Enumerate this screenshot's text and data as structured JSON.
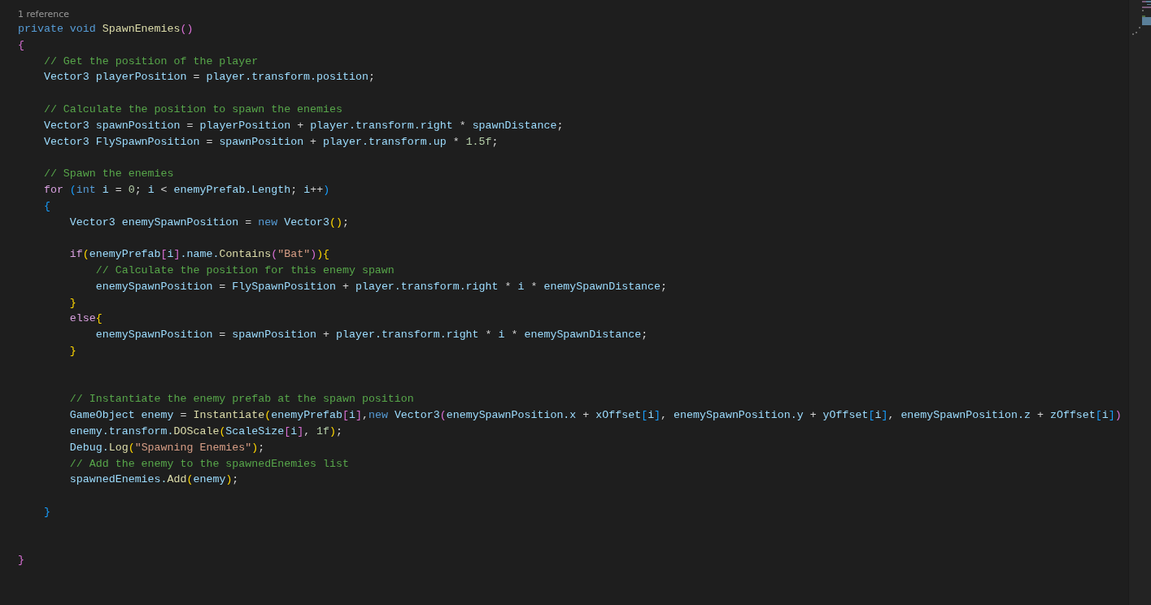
{
  "editor": {
    "code_lens": "1 reference",
    "lines": [
      {
        "kind": "code",
        "tokens": [
          {
            "text": "private void ",
            "kind": "kw"
          },
          {
            "text": "SpawnEnemies",
            "kind": "fn"
          },
          {
            "text": "()",
            "kind": "b2"
          }
        ]
      },
      {
        "kind": "code",
        "tokens": [
          {
            "text": "{",
            "kind": "b2"
          }
        ]
      },
      {
        "kind": "code",
        "tokens": [
          {
            "text": "    // Get the position of the player",
            "kind": "cm"
          }
        ]
      },
      {
        "kind": "code",
        "tokens": [
          {
            "text": "    Vector3 playerPosition",
            "kind": "id"
          },
          {
            "text": " = ",
            "kind": "op"
          },
          {
            "text": "player.transform.position",
            "kind": "id"
          },
          {
            "text": ";",
            "kind": "op"
          }
        ]
      },
      {
        "kind": "blank"
      },
      {
        "kind": "code",
        "tokens": [
          {
            "text": "    // Calculate the position to spawn the enemies",
            "kind": "cm"
          }
        ]
      },
      {
        "kind": "code",
        "tokens": [
          {
            "text": "    Vector3 spawnPosition",
            "kind": "id"
          },
          {
            "text": " = ",
            "kind": "op"
          },
          {
            "text": "playerPosition",
            "kind": "id"
          },
          {
            "text": " + ",
            "kind": "op"
          },
          {
            "text": "player.transform.right",
            "kind": "id"
          },
          {
            "text": " * ",
            "kind": "op"
          },
          {
            "text": "spawnDistance",
            "kind": "id"
          },
          {
            "text": ";",
            "kind": "op"
          }
        ]
      },
      {
        "kind": "code",
        "tokens": [
          {
            "text": "    Vector3 FlySpawnPosition",
            "kind": "id"
          },
          {
            "text": " = ",
            "kind": "op"
          },
          {
            "text": "spawnPosition",
            "kind": "id"
          },
          {
            "text": " + ",
            "kind": "op"
          },
          {
            "text": "player.transform.up",
            "kind": "id"
          },
          {
            "text": " * ",
            "kind": "op"
          },
          {
            "text": "1.5f",
            "kind": "num"
          },
          {
            "text": ";",
            "kind": "op"
          }
        ]
      },
      {
        "kind": "blank"
      },
      {
        "kind": "code",
        "tokens": [
          {
            "text": "    // Spawn the enemies",
            "kind": "cm"
          }
        ]
      },
      {
        "kind": "code",
        "tokens": [
          {
            "text": "    for ",
            "kind": "ctrl"
          },
          {
            "text": "(",
            "kind": "b3"
          },
          {
            "text": "int",
            "kind": "kw"
          },
          {
            "text": " i",
            "kind": "id"
          },
          {
            "text": " = ",
            "kind": "op"
          },
          {
            "text": "0",
            "kind": "num"
          },
          {
            "text": "; ",
            "kind": "op"
          },
          {
            "text": "i",
            "kind": "id"
          },
          {
            "text": " < ",
            "kind": "op"
          },
          {
            "text": "enemyPrefab.Length",
            "kind": "id"
          },
          {
            "text": "; ",
            "kind": "op"
          },
          {
            "text": "i",
            "kind": "id"
          },
          {
            "text": "++",
            "kind": "op"
          },
          {
            "text": ")",
            "kind": "b3"
          }
        ]
      },
      {
        "kind": "code",
        "tokens": [
          {
            "text": "    {",
            "kind": "b3"
          }
        ]
      },
      {
        "kind": "code",
        "tokens": [
          {
            "text": "        Vector3 enemySpawnPosition",
            "kind": "id"
          },
          {
            "text": " = ",
            "kind": "op"
          },
          {
            "text": "new",
            "kind": "kw"
          },
          {
            "text": " Vector3",
            "kind": "id"
          },
          {
            "text": "()",
            "kind": "b1"
          },
          {
            "text": ";",
            "kind": "op"
          }
        ]
      },
      {
        "kind": "blank"
      },
      {
        "kind": "code",
        "tokens": [
          {
            "text": "        if",
            "kind": "ctrl"
          },
          {
            "text": "(",
            "kind": "b1"
          },
          {
            "text": "enemyPrefab",
            "kind": "id"
          },
          {
            "text": "[",
            "kind": "b2"
          },
          {
            "text": "i",
            "kind": "id"
          },
          {
            "text": "]",
            "kind": "b2"
          },
          {
            "text": ".name.",
            "kind": "id"
          },
          {
            "text": "Contains",
            "kind": "fn"
          },
          {
            "text": "(",
            "kind": "b2"
          },
          {
            "text": "\"Bat\"",
            "kind": "str"
          },
          {
            "text": ")",
            "kind": "b2"
          },
          {
            "text": "){",
            "kind": "b1"
          }
        ]
      },
      {
        "kind": "code",
        "tokens": [
          {
            "text": "            // Calculate the position for this enemy spawn",
            "kind": "cm"
          }
        ]
      },
      {
        "kind": "code",
        "tokens": [
          {
            "text": "            enemySpawnPosition",
            "kind": "id"
          },
          {
            "text": " = ",
            "kind": "op"
          },
          {
            "text": "FlySpawnPosition",
            "kind": "id"
          },
          {
            "text": " + ",
            "kind": "op"
          },
          {
            "text": "player.transform.right",
            "kind": "id"
          },
          {
            "text": " * ",
            "kind": "op"
          },
          {
            "text": "i",
            "kind": "id"
          },
          {
            "text": " * ",
            "kind": "op"
          },
          {
            "text": "enemySpawnDistance",
            "kind": "id"
          },
          {
            "text": ";",
            "kind": "op"
          }
        ]
      },
      {
        "kind": "code",
        "tokens": [
          {
            "text": "        }",
            "kind": "b1"
          }
        ]
      },
      {
        "kind": "code",
        "tokens": [
          {
            "text": "        else",
            "kind": "ctrl"
          },
          {
            "text": "{",
            "kind": "b1"
          }
        ]
      },
      {
        "kind": "code",
        "tokens": [
          {
            "text": "            enemySpawnPosition",
            "kind": "id"
          },
          {
            "text": " = ",
            "kind": "op"
          },
          {
            "text": "spawnPosition",
            "kind": "id"
          },
          {
            "text": " + ",
            "kind": "op"
          },
          {
            "text": "player.transform.right",
            "kind": "id"
          },
          {
            "text": " * ",
            "kind": "op"
          },
          {
            "text": "i",
            "kind": "id"
          },
          {
            "text": " * ",
            "kind": "op"
          },
          {
            "text": "enemySpawnDistance",
            "kind": "id"
          },
          {
            "text": ";",
            "kind": "op"
          }
        ]
      },
      {
        "kind": "code",
        "tokens": [
          {
            "text": "        }",
            "kind": "b1"
          }
        ]
      },
      {
        "kind": "blank"
      },
      {
        "kind": "blank"
      },
      {
        "kind": "code",
        "tokens": [
          {
            "text": "        // Instantiate the enemy prefab at the spawn position",
            "kind": "cm"
          }
        ]
      },
      {
        "kind": "code",
        "tokens": [
          {
            "text": "        GameObject enemy",
            "kind": "id"
          },
          {
            "text": " = ",
            "kind": "op"
          },
          {
            "text": "Instantiate",
            "kind": "fn"
          },
          {
            "text": "(",
            "kind": "b1"
          },
          {
            "text": "enemyPrefab",
            "kind": "id"
          },
          {
            "text": "[",
            "kind": "b2"
          },
          {
            "text": "i",
            "kind": "id"
          },
          {
            "text": "]",
            "kind": "b2"
          },
          {
            "text": ",",
            "kind": "op"
          },
          {
            "text": "new",
            "kind": "kw"
          },
          {
            "text": " Vector3",
            "kind": "id"
          },
          {
            "text": "(",
            "kind": "b2"
          },
          {
            "text": "enemySpawnPosition.x",
            "kind": "id"
          },
          {
            "text": " + ",
            "kind": "op"
          },
          {
            "text": "xOffset",
            "kind": "id"
          },
          {
            "text": "[",
            "kind": "b3"
          },
          {
            "text": "i",
            "kind": "id"
          },
          {
            "text": "]",
            "kind": "b3"
          },
          {
            "text": ", ",
            "kind": "op"
          },
          {
            "text": "enemySpawnPosition.y",
            "kind": "id"
          },
          {
            "text": " + ",
            "kind": "op"
          },
          {
            "text": "yOffset",
            "kind": "id"
          },
          {
            "text": "[",
            "kind": "b3"
          },
          {
            "text": "i",
            "kind": "id"
          },
          {
            "text": "]",
            "kind": "b3"
          },
          {
            "text": ", ",
            "kind": "op"
          },
          {
            "text": "enemySpawnPosition.z",
            "kind": "id"
          },
          {
            "text": " + ",
            "kind": "op"
          },
          {
            "text": "zOffset",
            "kind": "id"
          },
          {
            "text": "[",
            "kind": "b3"
          },
          {
            "text": "i",
            "kind": "id"
          },
          {
            "text": "]",
            "kind": "b3"
          },
          {
            "text": ")",
            "kind": "b2"
          }
        ]
      },
      {
        "kind": "code",
        "tokens": [
          {
            "text": "        enemy.transform.",
            "kind": "id"
          },
          {
            "text": "DOScale",
            "kind": "fn"
          },
          {
            "text": "(",
            "kind": "b1"
          },
          {
            "text": "ScaleSize",
            "kind": "id"
          },
          {
            "text": "[",
            "kind": "b2"
          },
          {
            "text": "i",
            "kind": "id"
          },
          {
            "text": "]",
            "kind": "b2"
          },
          {
            "text": ", ",
            "kind": "op"
          },
          {
            "text": "1f",
            "kind": "num"
          },
          {
            "text": ")",
            "kind": "b1"
          },
          {
            "text": ";",
            "kind": "op"
          }
        ]
      },
      {
        "kind": "code",
        "tokens": [
          {
            "text": "        Debug.",
            "kind": "id"
          },
          {
            "text": "Log",
            "kind": "fn"
          },
          {
            "text": "(",
            "kind": "b1"
          },
          {
            "text": "\"Spawning Enemies\"",
            "kind": "str"
          },
          {
            "text": ")",
            "kind": "b1"
          },
          {
            "text": ";",
            "kind": "op"
          }
        ]
      },
      {
        "kind": "code",
        "tokens": [
          {
            "text": "        // Add the enemy to the spawnedEnemies list",
            "kind": "cm"
          }
        ]
      },
      {
        "kind": "code",
        "tokens": [
          {
            "text": "        spawnedEnemies.",
            "kind": "id"
          },
          {
            "text": "Add",
            "kind": "fn"
          },
          {
            "text": "(",
            "kind": "b1"
          },
          {
            "text": "enemy",
            "kind": "id"
          },
          {
            "text": ")",
            "kind": "b1"
          },
          {
            "text": ";",
            "kind": "op"
          }
        ]
      },
      {
        "kind": "blank"
      },
      {
        "kind": "code",
        "tokens": [
          {
            "text": "    }",
            "kind": "b3"
          }
        ]
      },
      {
        "kind": "blank"
      },
      {
        "kind": "blank"
      },
      {
        "kind": "code",
        "tokens": [
          {
            "text": "}",
            "kind": "b2"
          }
        ]
      }
    ]
  }
}
